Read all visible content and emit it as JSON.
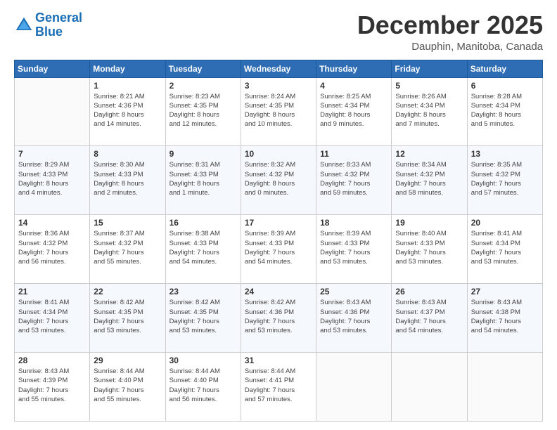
{
  "logo": {
    "line1": "General",
    "line2": "Blue"
  },
  "title": "December 2025",
  "subtitle": "Dauphin, Manitoba, Canada",
  "days_of_week": [
    "Sunday",
    "Monday",
    "Tuesday",
    "Wednesday",
    "Thursday",
    "Friday",
    "Saturday"
  ],
  "weeks": [
    [
      {
        "day": "",
        "info": ""
      },
      {
        "day": "1",
        "info": "Sunrise: 8:21 AM\nSunset: 4:36 PM\nDaylight: 8 hours\nand 14 minutes."
      },
      {
        "day": "2",
        "info": "Sunrise: 8:23 AM\nSunset: 4:35 PM\nDaylight: 8 hours\nand 12 minutes."
      },
      {
        "day": "3",
        "info": "Sunrise: 8:24 AM\nSunset: 4:35 PM\nDaylight: 8 hours\nand 10 minutes."
      },
      {
        "day": "4",
        "info": "Sunrise: 8:25 AM\nSunset: 4:34 PM\nDaylight: 8 hours\nand 9 minutes."
      },
      {
        "day": "5",
        "info": "Sunrise: 8:26 AM\nSunset: 4:34 PM\nDaylight: 8 hours\nand 7 minutes."
      },
      {
        "day": "6",
        "info": "Sunrise: 8:28 AM\nSunset: 4:34 PM\nDaylight: 8 hours\nand 5 minutes."
      }
    ],
    [
      {
        "day": "7",
        "info": "Sunrise: 8:29 AM\nSunset: 4:33 PM\nDaylight: 8 hours\nand 4 minutes."
      },
      {
        "day": "8",
        "info": "Sunrise: 8:30 AM\nSunset: 4:33 PM\nDaylight: 8 hours\nand 2 minutes."
      },
      {
        "day": "9",
        "info": "Sunrise: 8:31 AM\nSunset: 4:33 PM\nDaylight: 8 hours\nand 1 minute."
      },
      {
        "day": "10",
        "info": "Sunrise: 8:32 AM\nSunset: 4:32 PM\nDaylight: 8 hours\nand 0 minutes."
      },
      {
        "day": "11",
        "info": "Sunrise: 8:33 AM\nSunset: 4:32 PM\nDaylight: 7 hours\nand 59 minutes."
      },
      {
        "day": "12",
        "info": "Sunrise: 8:34 AM\nSunset: 4:32 PM\nDaylight: 7 hours\nand 58 minutes."
      },
      {
        "day": "13",
        "info": "Sunrise: 8:35 AM\nSunset: 4:32 PM\nDaylight: 7 hours\nand 57 minutes."
      }
    ],
    [
      {
        "day": "14",
        "info": "Sunrise: 8:36 AM\nSunset: 4:32 PM\nDaylight: 7 hours\nand 56 minutes."
      },
      {
        "day": "15",
        "info": "Sunrise: 8:37 AM\nSunset: 4:32 PM\nDaylight: 7 hours\nand 55 minutes."
      },
      {
        "day": "16",
        "info": "Sunrise: 8:38 AM\nSunset: 4:33 PM\nDaylight: 7 hours\nand 54 minutes."
      },
      {
        "day": "17",
        "info": "Sunrise: 8:39 AM\nSunset: 4:33 PM\nDaylight: 7 hours\nand 54 minutes."
      },
      {
        "day": "18",
        "info": "Sunrise: 8:39 AM\nSunset: 4:33 PM\nDaylight: 7 hours\nand 53 minutes."
      },
      {
        "day": "19",
        "info": "Sunrise: 8:40 AM\nSunset: 4:33 PM\nDaylight: 7 hours\nand 53 minutes."
      },
      {
        "day": "20",
        "info": "Sunrise: 8:41 AM\nSunset: 4:34 PM\nDaylight: 7 hours\nand 53 minutes."
      }
    ],
    [
      {
        "day": "21",
        "info": "Sunrise: 8:41 AM\nSunset: 4:34 PM\nDaylight: 7 hours\nand 53 minutes."
      },
      {
        "day": "22",
        "info": "Sunrise: 8:42 AM\nSunset: 4:35 PM\nDaylight: 7 hours\nand 53 minutes."
      },
      {
        "day": "23",
        "info": "Sunrise: 8:42 AM\nSunset: 4:35 PM\nDaylight: 7 hours\nand 53 minutes."
      },
      {
        "day": "24",
        "info": "Sunrise: 8:42 AM\nSunset: 4:36 PM\nDaylight: 7 hours\nand 53 minutes."
      },
      {
        "day": "25",
        "info": "Sunrise: 8:43 AM\nSunset: 4:36 PM\nDaylight: 7 hours\nand 53 minutes."
      },
      {
        "day": "26",
        "info": "Sunrise: 8:43 AM\nSunset: 4:37 PM\nDaylight: 7 hours\nand 54 minutes."
      },
      {
        "day": "27",
        "info": "Sunrise: 8:43 AM\nSunset: 4:38 PM\nDaylight: 7 hours\nand 54 minutes."
      }
    ],
    [
      {
        "day": "28",
        "info": "Sunrise: 8:43 AM\nSunset: 4:39 PM\nDaylight: 7 hours\nand 55 minutes."
      },
      {
        "day": "29",
        "info": "Sunrise: 8:44 AM\nSunset: 4:40 PM\nDaylight: 7 hours\nand 55 minutes."
      },
      {
        "day": "30",
        "info": "Sunrise: 8:44 AM\nSunset: 4:40 PM\nDaylight: 7 hours\nand 56 minutes."
      },
      {
        "day": "31",
        "info": "Sunrise: 8:44 AM\nSunset: 4:41 PM\nDaylight: 7 hours\nand 57 minutes."
      },
      {
        "day": "",
        "info": ""
      },
      {
        "day": "",
        "info": ""
      },
      {
        "day": "",
        "info": ""
      }
    ]
  ]
}
